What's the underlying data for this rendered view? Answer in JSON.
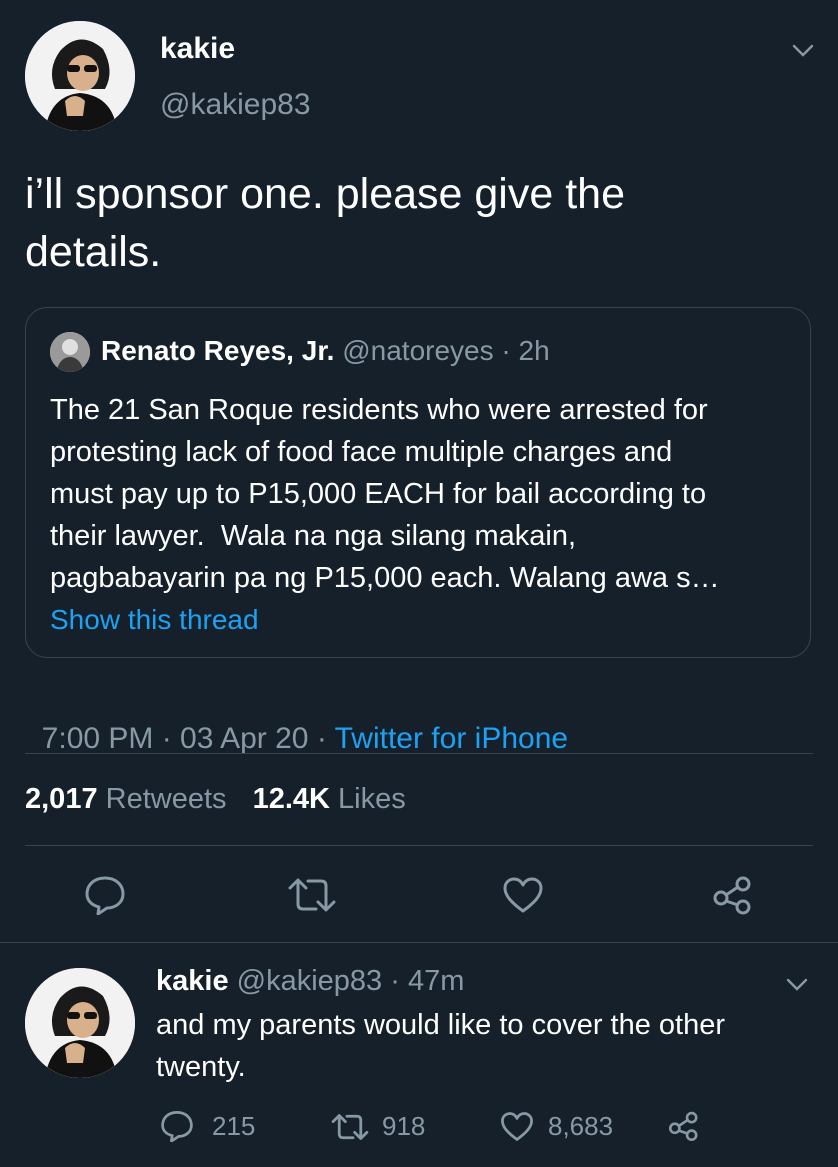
{
  "main_tweet": {
    "author_name": "kakie",
    "author_handle": "@kakiep83",
    "text": "i’ll sponsor one. please give the details.",
    "timestamp": "7:00 PM · 03 Apr 20 · ",
    "source": "Twitter for iPhone",
    "retweets_count": "2,017",
    "retweets_label": "Retweets",
    "likes_count": "12.4K",
    "likes_label": "Likes"
  },
  "quoted_tweet": {
    "author_name": "Renato Reyes, Jr.",
    "author_handle": "@natoreyes",
    "time": "· 2h",
    "lines": [
      "The 21 San Roque residents who were arrested for",
      "protesting lack of food face multiple charges and",
      "must pay up to P15,000 EACH for bail according to",
      "their lawyer.  Wala na nga silang makain,",
      "pagbabayarin pa ng P15,000 each. Walang awa s…"
    ],
    "show_thread": "Show this thread"
  },
  "reply_tweet": {
    "author_name": "kakie",
    "author_handle": "@kakiep83",
    "time": "· 47m",
    "line1": "and my parents would like to cover the other",
    "line2": "twenty.",
    "reply_count": "215",
    "retweet_count": "918",
    "like_count": "8,683"
  },
  "colors": {
    "background": "#15202b",
    "accent": "#1da1f2",
    "muted": "#8899a6",
    "divider": "#38444d"
  },
  "icons": [
    "chevron-down-icon",
    "reply-icon",
    "retweet-icon",
    "like-icon",
    "share-icon"
  ]
}
